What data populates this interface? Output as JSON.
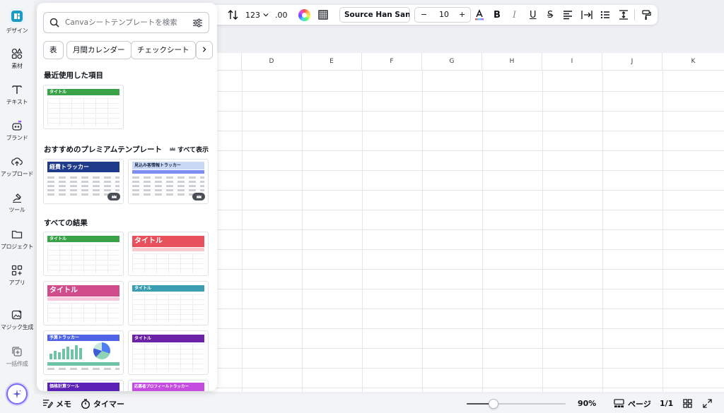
{
  "rail": {
    "items": [
      {
        "label": "デザイン",
        "icon": "canva-logo-icon"
      },
      {
        "label": "素材",
        "icon": "elements-icon"
      },
      {
        "label": "テキスト",
        "icon": "text-icon"
      },
      {
        "label": "ブランド",
        "icon": "brand-icon"
      },
      {
        "label": "アップロード",
        "icon": "upload-icon"
      },
      {
        "label": "ツール",
        "icon": "tools-icon"
      },
      {
        "label": "プロジェクト",
        "icon": "folder-icon"
      },
      {
        "label": "アプリ",
        "icon": "apps-icon"
      },
      {
        "label": "マジック生成",
        "icon": "magic-media-icon"
      },
      {
        "label": "一括作成",
        "icon": "bulk-create-icon"
      }
    ],
    "magic_button_icon": "sparkle-icon"
  },
  "toolbar": {
    "number_format": "123",
    "decimal_label": ".00",
    "font_name": "Source Han Sans ...",
    "font_size": "10",
    "minus": "−",
    "plus": "+",
    "bold": "B",
    "italic": "I",
    "underline": "U",
    "strike": "S"
  },
  "panel": {
    "search_placeholder": "Canvaシートテンプレートを検索",
    "chips": [
      "表",
      "月間カレンダー",
      "チェックシート"
    ],
    "recent_title": "最近使用した項目",
    "premium_title": "おすすめのプレミアムテンプレート",
    "see_all": "すべて表示",
    "all_results_title": "すべての結果",
    "recent_thumb": {
      "label": "タイトル",
      "color": "#3aa34a"
    },
    "premium_thumbs": [
      {
        "label": "経費トラッカー",
        "color": "#1f3a8a"
      },
      {
        "label": "見込み客情報トラッカー",
        "color": "#c9d8f5"
      }
    ],
    "result_thumbs": [
      {
        "label": "タイトル",
        "color": "#3aa34a",
        "style": "small"
      },
      {
        "label": "タイトル",
        "color": "#e8505b",
        "style": "big",
        "sub": "#f7c9cd"
      },
      {
        "label": "タイトル",
        "color": "#d14c8b",
        "style": "big",
        "sub": "#f6c7dc"
      },
      {
        "label": "タイトル",
        "color": "#3b9db0",
        "style": "small"
      },
      {
        "label": "予算トラッカー",
        "color": "#4f63e6",
        "style": "chart"
      },
      {
        "label": "タイトル",
        "color": "#6b21a8",
        "style": "small"
      },
      {
        "label": "価格計算ツール",
        "color": "#5b21b6",
        "style": "small"
      },
      {
        "label": "応募者プロフィールトラッカー",
        "color": "#c44de0",
        "style": "small"
      }
    ]
  },
  "sheet": {
    "columns": [
      "D",
      "E",
      "F",
      "G",
      "H",
      "I",
      "J",
      "K"
    ]
  },
  "bottombar": {
    "notes_label": "メモ",
    "timer_label": "タイマー",
    "zoom_label": "90%",
    "zoom_level": 0.27,
    "pages_label": "ページ",
    "page_count": "1/1"
  },
  "colors": {
    "accent": "#8b3dff",
    "panel_bg": "#ffffff",
    "rail_bg": "#f3f4f6"
  }
}
